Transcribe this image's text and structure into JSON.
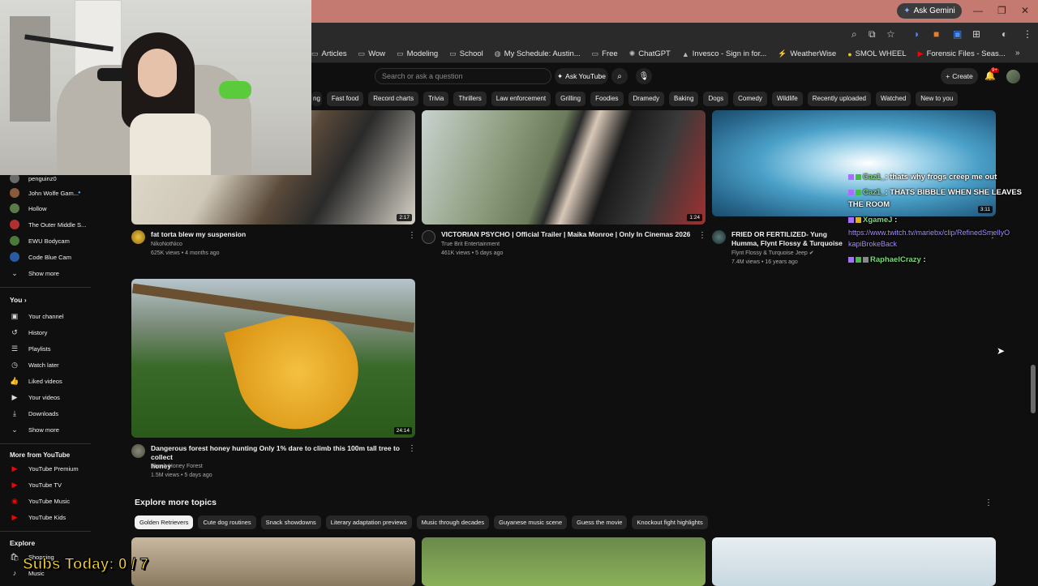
{
  "browser": {
    "ask_gemini": "Ask Gemini",
    "bookmarks": [
      {
        "label": "Articles",
        "icon": "folder-icon"
      },
      {
        "label": "Wow",
        "icon": "folder-icon"
      },
      {
        "label": "Modeling",
        "icon": "folder-icon"
      },
      {
        "label": "School",
        "icon": "folder-icon"
      },
      {
        "label": "My Schedule: Austin...",
        "icon": "globe-icon"
      },
      {
        "label": "Free",
        "icon": "folder-icon"
      },
      {
        "label": "ChatGPT",
        "icon": "chatgpt-icon"
      },
      {
        "label": "Invesco - Sign in for...",
        "icon": "invesco-icon"
      },
      {
        "label": "WeatherWise",
        "icon": "weather-icon"
      },
      {
        "label": "SMOL WHEEL",
        "icon": "wheel-icon"
      },
      {
        "label": "Forensic Files - Seas...",
        "icon": "youtube-icon"
      }
    ]
  },
  "yt_header": {
    "search_placeholder": "Search or ask a question",
    "ask_youtube": "Ask YouTube",
    "create": "Create",
    "notif_count": "9+"
  },
  "chips": [
    "ng",
    "Fast food",
    "Record charts",
    "Trivia",
    "Thrillers",
    "Law enforcement",
    "Grilling",
    "Foodies",
    "Dramedy",
    "Baking",
    "Dogs",
    "Comedy",
    "Wildlife",
    "Recently uploaded",
    "Watched",
    "New to you"
  ],
  "sidebar": {
    "subscriptions": [
      {
        "label": "penguinz0"
      },
      {
        "label": "John Wolfe Gam..."
      },
      {
        "label": "Hollow"
      },
      {
        "label": "The Outer Middle S..."
      },
      {
        "label": "EWU Bodycam"
      },
      {
        "label": "Code Blue Cam"
      }
    ],
    "show_more_1": "Show more",
    "you_header": "You",
    "you_items": [
      {
        "label": "Your channel"
      },
      {
        "label": "History"
      },
      {
        "label": "Playlists"
      },
      {
        "label": "Watch later"
      },
      {
        "label": "Liked videos"
      },
      {
        "label": "Your videos"
      },
      {
        "label": "Downloads"
      },
      {
        "label": "Show more"
      }
    ],
    "more_header": "More from YouTube",
    "more_items": [
      {
        "label": "YouTube Premium"
      },
      {
        "label": "YouTube TV"
      },
      {
        "label": "YouTube Music"
      },
      {
        "label": "YouTube Kids"
      }
    ],
    "explore_header": "Explore",
    "explore_items": [
      {
        "label": "Shopping"
      },
      {
        "label": "Music"
      }
    ]
  },
  "videos": [
    {
      "title": "fat torta blew my suspension",
      "channel": "NikoNotNico",
      "meta": "625K views • 4 months ago",
      "duration": "2:17"
    },
    {
      "title": "VICTORIAN PSYCHO | Official Trailer | Maika Monroe | Only In Cinemas 2026",
      "channel": "True Brit Entertainment",
      "meta": "461K views • 5 days ago",
      "duration": "1:24"
    },
    {
      "title": "FRIED OR FERTILIZED- Yung Humma, Flynt Flossy & Turquoise Jeep (@RealFlyntFloss)",
      "channel": "Flynt Flossy & Turquoise Jeep",
      "meta": "7.4M views • 16 years ago",
      "duration": "3:11"
    },
    {
      "title_line1": "Dangerous forest honey hunting  Only 1% dare to climb this 100m tall tree to collect",
      "title_line2": "honey",
      "channel": "Thanh Honey Forest",
      "meta": "1.5M views • 5 days ago",
      "duration": "24:14"
    }
  ],
  "explore": {
    "title": "Explore more topics",
    "chips": [
      "Golden Retrievers",
      "Cute dog routines",
      "Snack showdowns",
      "Literary adaptation previews",
      "Music through decades",
      "Guyanese music scene",
      "Guess the movie",
      "Knockout fight highlights"
    ]
  },
  "chat": [
    {
      "user": "Caz1_",
      "text": ": thats why frogs creep me out"
    },
    {
      "user": "Caz1_",
      "text": ": THATS BIBBLE WHEN SHE LEAVES"
    },
    {
      "text": "THE ROOM"
    },
    {
      "user": "XgameJ",
      "text": " :"
    },
    {
      "link": "https://www.twitch.tv/mariebx/clip/RefinedSmellyO"
    },
    {
      "link": "kapiBrokeBack"
    },
    {
      "user": "RaphaelCrazy",
      "text": " :"
    }
  ],
  "overlay": {
    "subs": "Subs Today: 0 / 7"
  },
  "colors": {
    "titlebar": "#c47a70",
    "bg": "#0f0f0f",
    "chip": "#272727",
    "subs": "#f7d13a",
    "chat_user": "#7cd67c",
    "link": "#a98bff"
  }
}
